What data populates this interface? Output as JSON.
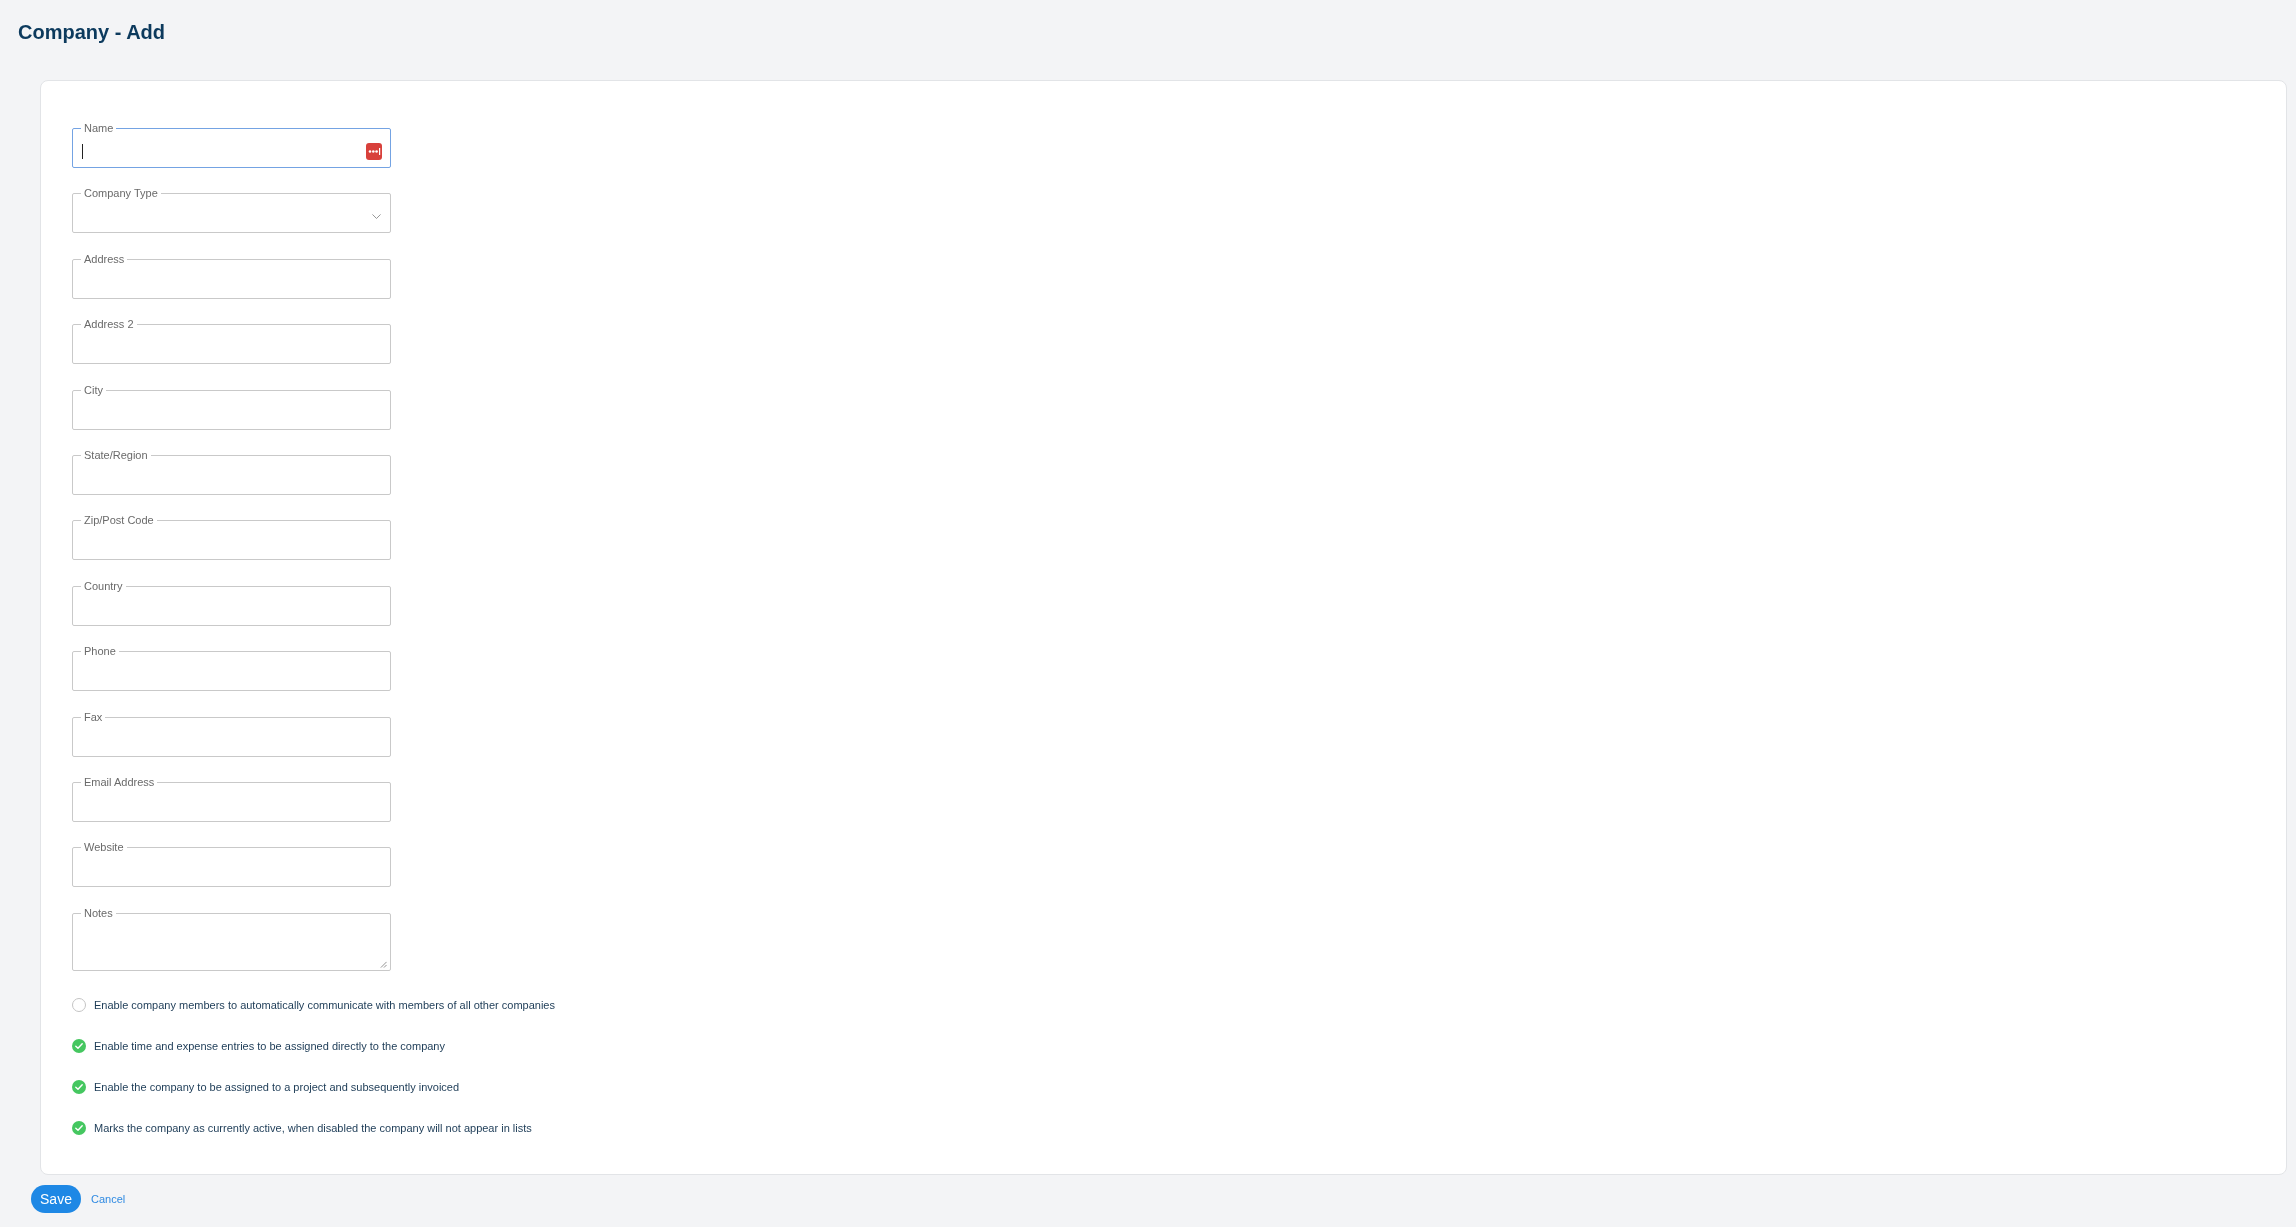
{
  "page": {
    "title": "Company - Add"
  },
  "form": {
    "fields": [
      {
        "label": "Name",
        "kind": "text",
        "focused": true
      },
      {
        "label": "Company Type",
        "kind": "select",
        "focused": false
      },
      {
        "label": "Address",
        "kind": "text",
        "focused": false
      },
      {
        "label": "Address 2",
        "kind": "text",
        "focused": false
      },
      {
        "label": "City",
        "kind": "text",
        "focused": false
      },
      {
        "label": "State/Region",
        "kind": "text",
        "focused": false
      },
      {
        "label": "Zip/Post Code",
        "kind": "text",
        "focused": false
      },
      {
        "label": "Country",
        "kind": "text",
        "focused": false
      },
      {
        "label": "Phone",
        "kind": "text",
        "focused": false
      },
      {
        "label": "Fax",
        "kind": "text",
        "focused": false
      },
      {
        "label": "Email Address",
        "kind": "text",
        "focused": false
      },
      {
        "label": "Website",
        "kind": "text",
        "focused": false
      },
      {
        "label": "Notes",
        "kind": "textarea",
        "focused": false
      }
    ],
    "options": [
      {
        "label": "Enable company members to automatically communicate with members of all other companies",
        "checked": false
      },
      {
        "label": "Enable time and expense entries to be assigned directly to the company",
        "checked": true
      },
      {
        "label": "Enable the company to be assigned to a project and subsequently invoiced",
        "checked": true
      },
      {
        "label": "Marks the company as currently active, when disabled the company will not appear in lists",
        "checked": true
      }
    ]
  },
  "actions": {
    "save": "Save",
    "cancel": "Cancel"
  }
}
